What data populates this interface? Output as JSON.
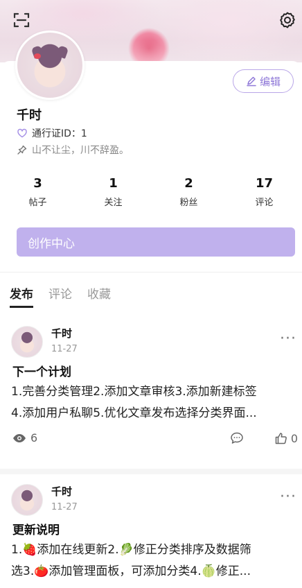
{
  "header": {
    "scan_icon": "scan-icon",
    "settings_icon": "gear-icon"
  },
  "profile": {
    "name": "千时",
    "pass_id_label": "通行证ID：1",
    "bio": "山不让尘，川不辞盈。",
    "edit_label": "编辑",
    "accent_color": "#8f78d8"
  },
  "stats": [
    {
      "value": "3",
      "label": "帖子"
    },
    {
      "value": "1",
      "label": "关注"
    },
    {
      "value": "2",
      "label": "粉丝"
    },
    {
      "value": "17",
      "label": "评论"
    }
  ],
  "creator_center_label": "创作中心",
  "tabs": [
    {
      "label": "发布",
      "active": true
    },
    {
      "label": "评论",
      "active": false
    },
    {
      "label": "收藏",
      "active": false
    }
  ],
  "posts": [
    {
      "author": "千时",
      "date": "11-27",
      "title": "下一个计划",
      "body_line1": "1.完善分类管理2.添加文章审核3.添加新建标签",
      "body_line2": "4.添加用户私聊5.优化文章发布选择分类界面...",
      "views": "6",
      "likes": "0"
    },
    {
      "author": "千时",
      "date": "11-27",
      "title": "更新说明",
      "body_line1": "1.🍓添加在线更新2.🥬修正分类排序及数据筛",
      "body_line2": "选3.🍅添加管理面板，可添加分类4.🍈修正..."
    }
  ]
}
